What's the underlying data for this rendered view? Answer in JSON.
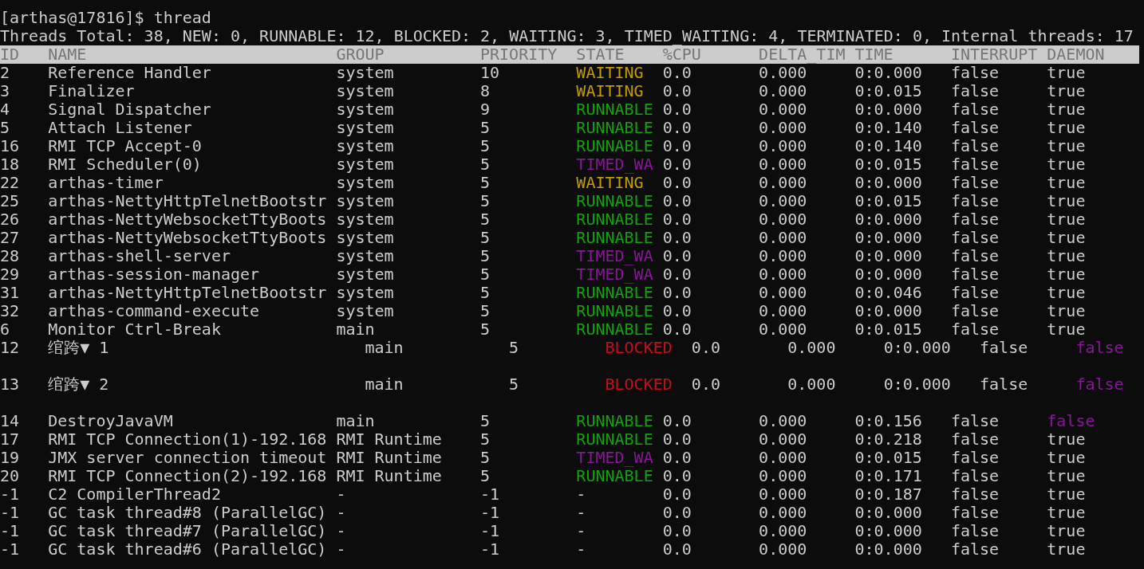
{
  "prompt_line": "[arthas@17816]$ thread",
  "summary": "Threads Total: 38, NEW: 0, RUNNABLE: 12, BLOCKED: 2, WAITING: 3, TIMED_WAITING: 4, TERMINATED: 0, Internal threads: 17",
  "table": {
    "columns": [
      "ID",
      "NAME",
      "GROUP",
      "PRIORITY",
      "STATE",
      "%CPU",
      "DELTA_TIM",
      "TIME",
      "INTERRUPT",
      "DAEMON"
    ],
    "rows": [
      {
        "kind": "normal",
        "id": "2",
        "name": "Reference Handler",
        "group": "system",
        "priority": "10",
        "state": {
          "text": "WAITING",
          "color": "#c19c00"
        },
        "cpu": "0.0",
        "delta_time": "0.000",
        "time": "0:0.000",
        "interrupt": "false",
        "daemon": {
          "text": "true",
          "color": "#cccccc"
        }
      },
      {
        "kind": "normal",
        "id": "3",
        "name": "Finalizer",
        "group": "system",
        "priority": "8",
        "state": {
          "text": "WAITING",
          "color": "#c19c00"
        },
        "cpu": "0.0",
        "delta_time": "0.000",
        "time": "0:0.015",
        "interrupt": "false",
        "daemon": {
          "text": "true",
          "color": "#cccccc"
        }
      },
      {
        "kind": "normal",
        "id": "4",
        "name": "Signal Dispatcher",
        "group": "system",
        "priority": "9",
        "state": {
          "text": "RUNNABLE",
          "color": "#13a10e"
        },
        "cpu": "0.0",
        "delta_time": "0.000",
        "time": "0:0.000",
        "interrupt": "false",
        "daemon": {
          "text": "true",
          "color": "#cccccc"
        }
      },
      {
        "kind": "normal",
        "id": "5",
        "name": "Attach Listener",
        "group": "system",
        "priority": "5",
        "state": {
          "text": "RUNNABLE",
          "color": "#13a10e"
        },
        "cpu": "0.0",
        "delta_time": "0.000",
        "time": "0:0.140",
        "interrupt": "false",
        "daemon": {
          "text": "true",
          "color": "#cccccc"
        }
      },
      {
        "kind": "normal",
        "id": "16",
        "name": "RMI TCP Accept-0",
        "group": "system",
        "priority": "5",
        "state": {
          "text": "RUNNABLE",
          "color": "#13a10e"
        },
        "cpu": "0.0",
        "delta_time": "0.000",
        "time": "0:0.140",
        "interrupt": "false",
        "daemon": {
          "text": "true",
          "color": "#cccccc"
        }
      },
      {
        "kind": "normal",
        "id": "18",
        "name": "RMI Scheduler(0)",
        "group": "system",
        "priority": "5",
        "state": {
          "text": "TIMED_WA",
          "color": "#881798"
        },
        "cpu": "0.0",
        "delta_time": "0.000",
        "time": "0:0.015",
        "interrupt": "false",
        "daemon": {
          "text": "true",
          "color": "#cccccc"
        }
      },
      {
        "kind": "normal",
        "id": "22",
        "name": "arthas-timer",
        "group": "system",
        "priority": "5",
        "state": {
          "text": "WAITING",
          "color": "#c19c00"
        },
        "cpu": "0.0",
        "delta_time": "0.000",
        "time": "0:0.000",
        "interrupt": "false",
        "daemon": {
          "text": "true",
          "color": "#cccccc"
        }
      },
      {
        "kind": "normal",
        "id": "25",
        "name": "arthas-NettyHttpTelnetBootstr",
        "group": "system",
        "priority": "5",
        "state": {
          "text": "RUNNABLE",
          "color": "#13a10e"
        },
        "cpu": "0.0",
        "delta_time": "0.000",
        "time": "0:0.015",
        "interrupt": "false",
        "daemon": {
          "text": "true",
          "color": "#cccccc"
        }
      },
      {
        "kind": "normal",
        "id": "26",
        "name": "arthas-NettyWebsocketTtyBoots",
        "group": "system",
        "priority": "5",
        "state": {
          "text": "RUNNABLE",
          "color": "#13a10e"
        },
        "cpu": "0.0",
        "delta_time": "0.000",
        "time": "0:0.000",
        "interrupt": "false",
        "daemon": {
          "text": "true",
          "color": "#cccccc"
        }
      },
      {
        "kind": "normal",
        "id": "27",
        "name": "arthas-NettyWebsocketTtyBoots",
        "group": "system",
        "priority": "5",
        "state": {
          "text": "RUNNABLE",
          "color": "#13a10e"
        },
        "cpu": "0.0",
        "delta_time": "0.000",
        "time": "0:0.000",
        "interrupt": "false",
        "daemon": {
          "text": "true",
          "color": "#cccccc"
        }
      },
      {
        "kind": "normal",
        "id": "28",
        "name": "arthas-shell-server",
        "group": "system",
        "priority": "5",
        "state": {
          "text": "TIMED_WA",
          "color": "#881798"
        },
        "cpu": "0.0",
        "delta_time": "0.000",
        "time": "0:0.000",
        "interrupt": "false",
        "daemon": {
          "text": "true",
          "color": "#cccccc"
        }
      },
      {
        "kind": "normal",
        "id": "29",
        "name": "arthas-session-manager",
        "group": "system",
        "priority": "5",
        "state": {
          "text": "TIMED_WA",
          "color": "#881798"
        },
        "cpu": "0.0",
        "delta_time": "0.000",
        "time": "0:0.000",
        "interrupt": "false",
        "daemon": {
          "text": "true",
          "color": "#cccccc"
        }
      },
      {
        "kind": "normal",
        "id": "31",
        "name": "arthas-NettyHttpTelnetBootstr",
        "group": "system",
        "priority": "5",
        "state": {
          "text": "RUNNABLE",
          "color": "#13a10e"
        },
        "cpu": "0.0",
        "delta_time": "0.000",
        "time": "0:0.046",
        "interrupt": "false",
        "daemon": {
          "text": "true",
          "color": "#cccccc"
        }
      },
      {
        "kind": "normal",
        "id": "32",
        "name": "arthas-command-execute",
        "group": "system",
        "priority": "5",
        "state": {
          "text": "RUNNABLE",
          "color": "#13a10e"
        },
        "cpu": "0.0",
        "delta_time": "0.000",
        "time": "0:0.000",
        "interrupt": "false",
        "daemon": {
          "text": "true",
          "color": "#cccccc"
        }
      },
      {
        "kind": "normal",
        "id": "6",
        "name": "Monitor Ctrl-Break",
        "group": "main",
        "priority": "5",
        "state": {
          "text": "RUNNABLE",
          "color": "#13a10e"
        },
        "cpu": "0.0",
        "delta_time": "0.000",
        "time": "0:0.015",
        "interrupt": "false",
        "daemon": {
          "text": "true",
          "color": "#cccccc"
        }
      },
      {
        "kind": "wide",
        "id": "12",
        "name": "绾跨▼ 1",
        "group": "main",
        "priority": "5",
        "state": {
          "text": "BLOCKED",
          "color": "#c50f1f"
        },
        "cpu": "0.0",
        "delta_time": "0.000",
        "time": "0:0.000",
        "interrupt": "false",
        "daemon": {
          "text": "false",
          "color": "#881798"
        }
      },
      {
        "kind": "wide",
        "id": "13",
        "name": "绾跨▼ 2",
        "group": "main",
        "priority": "5",
        "state": {
          "text": "BLOCKED",
          "color": "#c50f1f"
        },
        "cpu": "0.0",
        "delta_time": "0.000",
        "time": "0:0.000",
        "interrupt": "false",
        "daemon": {
          "text": "false",
          "color": "#881798"
        }
      },
      {
        "kind": "normal",
        "id": "14",
        "name": "DestroyJavaVM",
        "group": "main",
        "priority": "5",
        "state": {
          "text": "RUNNABLE",
          "color": "#13a10e"
        },
        "cpu": "0.0",
        "delta_time": "0.000",
        "time": "0:0.156",
        "interrupt": "false",
        "daemon": {
          "text": "false",
          "color": "#881798"
        }
      },
      {
        "kind": "normal",
        "id": "17",
        "name": "RMI TCP Connection(1)-192.168",
        "group": "RMI Runtime",
        "priority": "5",
        "state": {
          "text": "RUNNABLE",
          "color": "#13a10e"
        },
        "cpu": "0.0",
        "delta_time": "0.000",
        "time": "0:0.218",
        "interrupt": "false",
        "daemon": {
          "text": "true",
          "color": "#cccccc"
        }
      },
      {
        "kind": "normal",
        "id": "19",
        "name": "JMX server connection timeout",
        "group": "RMI Runtime",
        "priority": "5",
        "state": {
          "text": "TIMED_WA",
          "color": "#881798"
        },
        "cpu": "0.0",
        "delta_time": "0.000",
        "time": "0:0.015",
        "interrupt": "false",
        "daemon": {
          "text": "true",
          "color": "#cccccc"
        }
      },
      {
        "kind": "normal",
        "id": "20",
        "name": "RMI TCP Connection(2)-192.168",
        "group": "RMI Runtime",
        "priority": "5",
        "state": {
          "text": "RUNNABLE",
          "color": "#13a10e"
        },
        "cpu": "0.0",
        "delta_time": "0.000",
        "time": "0:0.171",
        "interrupt": "false",
        "daemon": {
          "text": "true",
          "color": "#cccccc"
        }
      },
      {
        "kind": "normal",
        "id": "-1",
        "name": "C2 CompilerThread2",
        "group": "-",
        "priority": "-1",
        "state": {
          "text": "-",
          "color": "#cccccc"
        },
        "cpu": "0.0",
        "delta_time": "0.000",
        "time": "0:0.187",
        "interrupt": "false",
        "daemon": {
          "text": "true",
          "color": "#cccccc"
        }
      },
      {
        "kind": "normal",
        "id": "-1",
        "name": "GC task thread#8 (ParallelGC)",
        "group": "-",
        "priority": "-1",
        "state": {
          "text": "-",
          "color": "#cccccc"
        },
        "cpu": "0.0",
        "delta_time": "0.000",
        "time": "0:0.000",
        "interrupt": "false",
        "daemon": {
          "text": "true",
          "color": "#cccccc"
        }
      },
      {
        "kind": "normal",
        "id": "-1",
        "name": "GC task thread#7 (ParallelGC)",
        "group": "-",
        "priority": "-1",
        "state": {
          "text": "-",
          "color": "#cccccc"
        },
        "cpu": "0.0",
        "delta_time": "0.000",
        "time": "0:0.000",
        "interrupt": "false",
        "daemon": {
          "text": "true",
          "color": "#cccccc"
        }
      },
      {
        "kind": "normal",
        "id": "-1",
        "name": "GC task thread#6 (ParallelGC)",
        "group": "-",
        "priority": "-1",
        "state": {
          "text": "-",
          "color": "#cccccc"
        },
        "cpu": "0.0",
        "delta_time": "0.000",
        "time": "0:0.000",
        "interrupt": "false",
        "daemon": {
          "text": "true",
          "color": "#cccccc"
        }
      }
    ]
  }
}
